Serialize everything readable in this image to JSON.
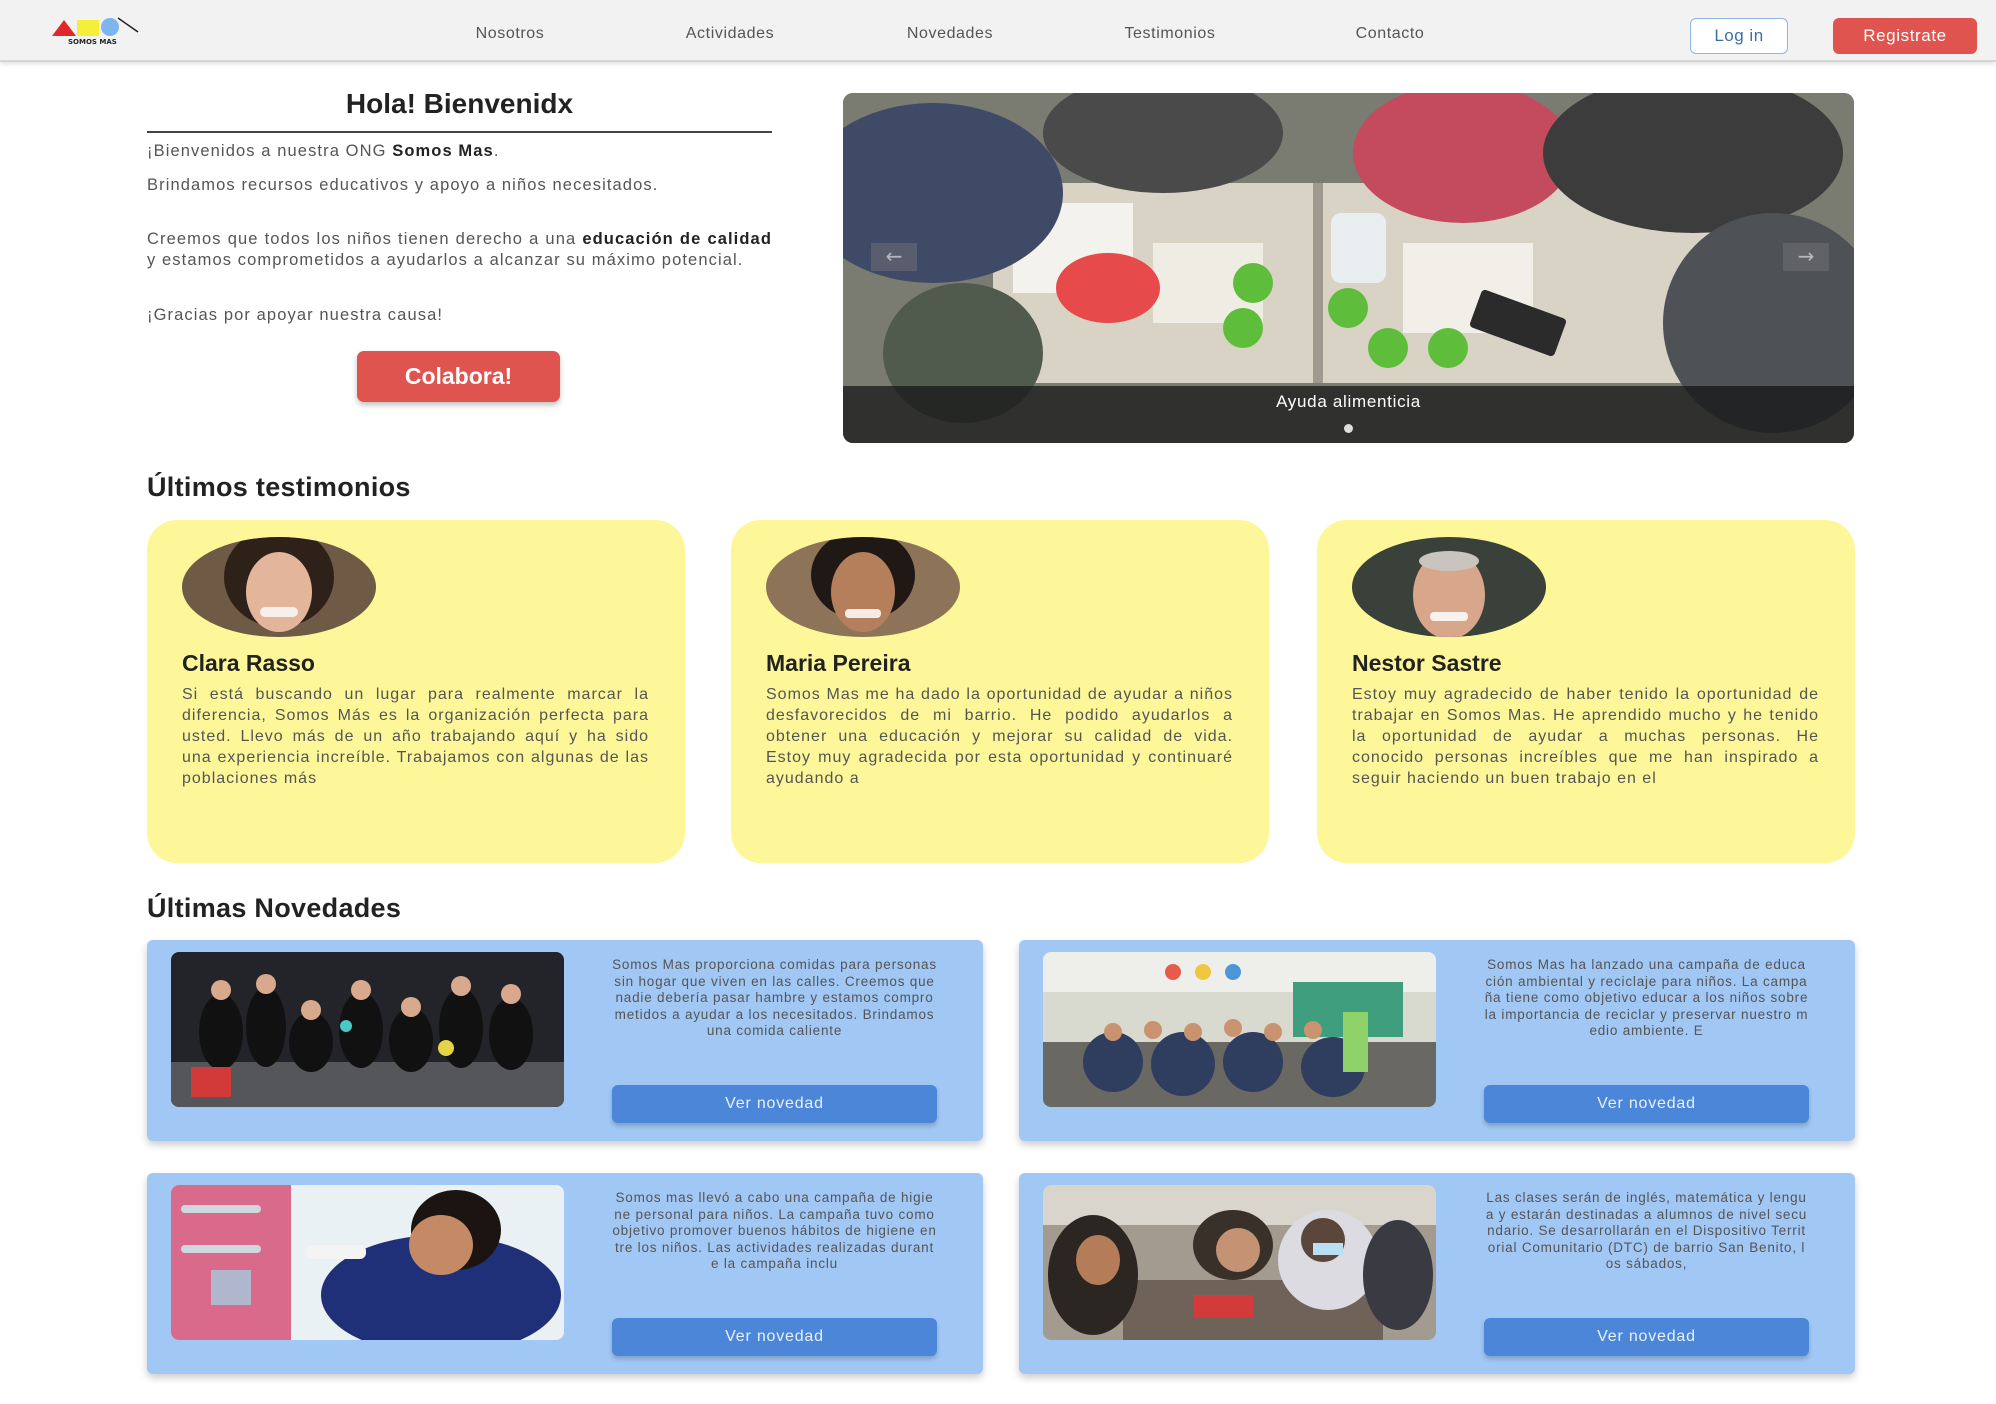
{
  "brand": {
    "logo_text": "SOMOS MAS"
  },
  "nav": {
    "links": [
      "Nosotros",
      "Actividades",
      "Novedades",
      "Testimonios",
      "Contacto"
    ],
    "login": "Log in",
    "register": "Registrate"
  },
  "hero": {
    "title": "Hola! Bienvenidx",
    "p1_pre": "¡Bienvenidos a nuestra ONG ",
    "p1_bold": "Somos Mas",
    "p1_post": ".",
    "p2": "Brindamos recursos educativos y apoyo a niños necesitados.",
    "p3_pre": "Creemos que todos los niños tienen derecho a una ",
    "p3_bold": "educación de calidad",
    "p3_post": " y estamos comprometidos a ayudarlos a alcanzar su máximo potencial.",
    "p4": "¡Gracias por apoyar nuestra causa!",
    "cta": "Colabora!"
  },
  "carousel": {
    "caption": "Ayuda alimenticia",
    "prev": "←",
    "next": "→"
  },
  "testimonials": {
    "title": "Últimos testimonios",
    "items": [
      {
        "name": "Clara Rasso",
        "text": "Si está buscando un lugar para realmente marcar la diferencia, Somos Más es la organización perfecta para usted. Llevo más de un año trabajando aquí y ha sido una experiencia increíble. Trabajamos con algunas de las poblaciones más"
      },
      {
        "name": "Maria Pereira",
        "text": "Somos Mas me ha dado la oportunidad de ayudar a niños desfavorecidos de mi barrio. He podido ayudarlos a obtener una educación y mejorar su calidad de vida. Estoy muy agradecida por esta oportunidad y continuaré ayudando a"
      },
      {
        "name": "Nestor Sastre",
        "text": "Estoy muy agradecido de haber tenido la oportunidad de trabajar en Somos Mas. He aprendido mucho y he tenido la oportunidad de ayudar a muchas personas. He conocido personas increíbles que me han inspirado a seguir haciendo un buen trabajo en el"
      }
    ]
  },
  "news": {
    "title": "Últimas Novedades",
    "button": "Ver novedad",
    "items": [
      {
        "text": "Somos Mas proporciona comidas para personas sin hogar que viven en las calles. Creemos que nadie debería pasar hambre y estamos comprometidos a ayudar a los necesitados. Brindamos una comida caliente"
      },
      {
        "text": "Somos Mas ha lanzado una campaña de educación ambiental y reciclaje para niños. La campaña tiene como objetivo educar a los niños sobre la importancia de reciclar y preservar nuestro medio ambiente. E"
      },
      {
        "text": "Somos mas llevó a cabo una campaña de higiene personal para niños. La campaña tuvo como objetivo promover buenos hábitos de higiene entre los niños. Las actividades realizadas durante la campaña inclu"
      },
      {
        "text": "Las clases serán de inglés, matemática y lengua y estarán destinadas a alumnos de nivel secundario. Se desarrollarán en el Dispositivo Territorial Comunitario (DTC) de barrio San Benito, los sábados,"
      }
    ]
  }
}
